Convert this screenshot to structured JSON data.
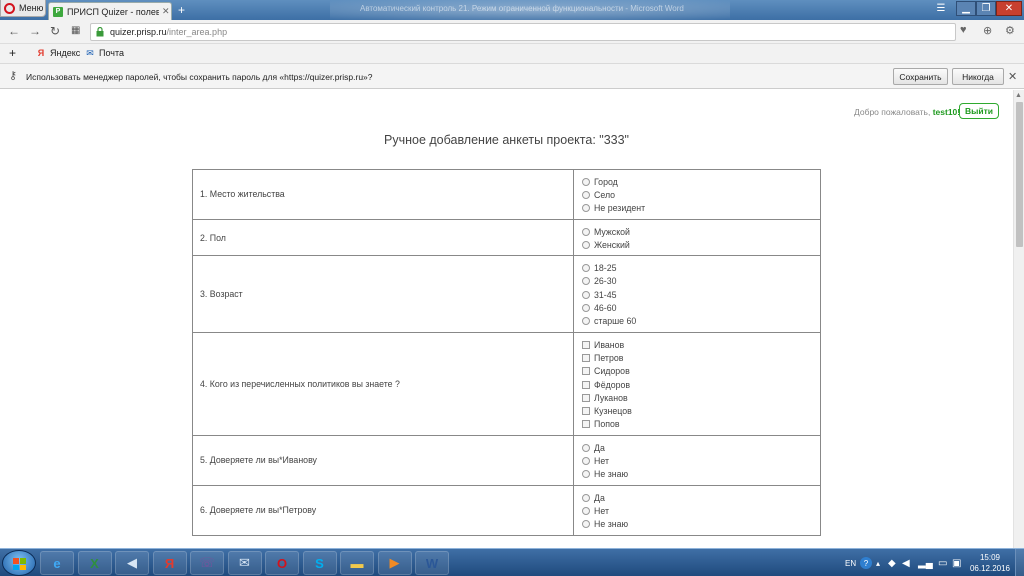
{
  "browser": {
    "menu_label": "Меню",
    "tab_title": "ПРИСП Quizer - полевая",
    "tab_favicon": "P",
    "window_title": "Автоматический контроль 21. Режим ограниченной функциональности - Microsoft Word",
    "url_host": "quizer.prisp.ru",
    "url_path": "/inter_area.php",
    "bookmarks": [
      {
        "label": "Яндекс",
        "icon": "Я"
      },
      {
        "label": "Почта",
        "icon": "✉"
      }
    ],
    "password_bar": {
      "message": "Использовать менеджер паролей, чтобы сохранить пароль для «https://quizer.prisp.ru»?",
      "save_label": "Сохранить",
      "never_label": "Никогда"
    }
  },
  "page": {
    "welcome_prefix": "Добро пожаловать,",
    "username": "test10!",
    "logout_label": "Выйти",
    "title": "Ручное добавление анкеты проекта: \"333\"",
    "questions": [
      {
        "text": "1. Место жительства",
        "type": "radio",
        "options": [
          "Город",
          "Село",
          "Не резидент"
        ]
      },
      {
        "text": "2. Пол",
        "type": "radio",
        "options": [
          "Мужской",
          "Женский"
        ]
      },
      {
        "text": "3. Возраст",
        "type": "radio",
        "options": [
          "18-25",
          "26-30",
          "31-45",
          "46-60",
          "старше 60"
        ]
      },
      {
        "text": "4. Кого из перечисленных политиков вы знаете ?",
        "type": "checkbox",
        "options": [
          "Иванов",
          "Петров",
          "Сидоров",
          "Фёдоров",
          "Луканов",
          "Кузнецов",
          "Попов"
        ]
      },
      {
        "text": "5. Доверяете ли вы*Иванову",
        "type": "radio",
        "options": [
          "Да",
          "Нет",
          "Не знаю"
        ]
      },
      {
        "text": "6. Доверяете ли вы*Петрову",
        "type": "radio",
        "options": [
          "Да",
          "Нет",
          "Не знаю"
        ]
      }
    ]
  },
  "taskbar": {
    "apps": [
      {
        "name": "ie-icon",
        "glyph": "e",
        "color": "#3fa9f5"
      },
      {
        "name": "excel-icon",
        "glyph": "X",
        "color": "#2f8f3f"
      },
      {
        "name": "speaker-app-icon",
        "glyph": "◀",
        "color": "#d8e6f5"
      },
      {
        "name": "yandex-icon",
        "glyph": "Я",
        "color": "#e23b2e"
      },
      {
        "name": "viber-icon",
        "glyph": "☏",
        "color": "#7b519d"
      },
      {
        "name": "mail-icon",
        "glyph": "✉",
        "color": "#d8e6f5"
      },
      {
        "name": "opera-icon",
        "glyph": "O",
        "color": "#d3131d"
      },
      {
        "name": "skype-icon",
        "glyph": "S",
        "color": "#00aff0"
      },
      {
        "name": "folder-icon",
        "glyph": "▬",
        "color": "#f2c94c"
      },
      {
        "name": "media-player-icon",
        "glyph": "▶",
        "color": "#f08a24"
      },
      {
        "name": "word-icon",
        "glyph": "W",
        "color": "#2b5797"
      }
    ],
    "language": "EN",
    "time": "15:09",
    "date": "06.12.2016"
  }
}
